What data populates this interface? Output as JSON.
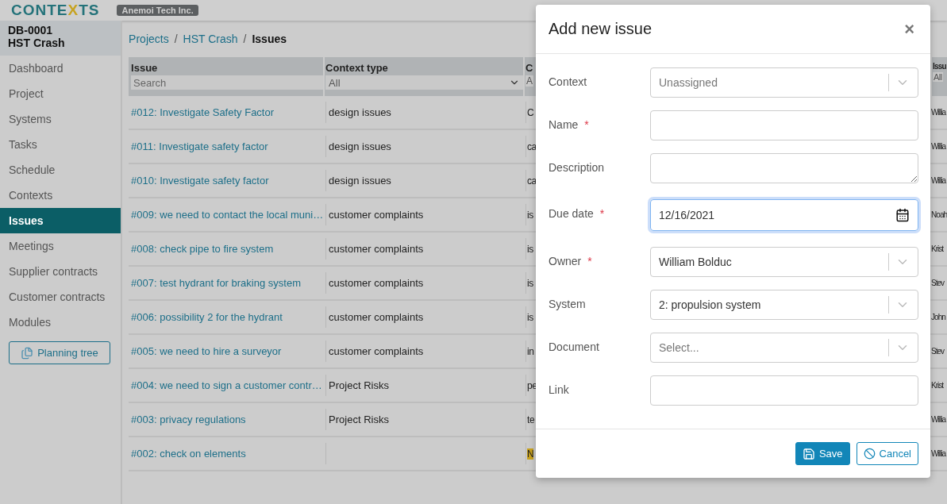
{
  "header": {
    "logo": {
      "before": "CONTE",
      "accent": "X",
      "after": "TS"
    },
    "company": "Anemoi Tech Inc."
  },
  "project": {
    "code": "DB-0001",
    "name": "HST Crash"
  },
  "sidebar": {
    "items": [
      {
        "label": "Dashboard",
        "selected": false
      },
      {
        "label": "Project",
        "selected": false
      },
      {
        "label": "Systems",
        "selected": false
      },
      {
        "label": "Tasks",
        "selected": false
      },
      {
        "label": "Schedule",
        "selected": false
      },
      {
        "label": "Contexts",
        "selected": false
      },
      {
        "label": "Issues",
        "selected": true
      },
      {
        "label": "Meetings",
        "selected": false
      },
      {
        "label": "Supplier contracts",
        "selected": false
      },
      {
        "label": "Customer contracts",
        "selected": false
      },
      {
        "label": "Modules",
        "selected": false
      }
    ],
    "button": "Planning tree"
  },
  "breadcrumb": [
    {
      "label": "Projects",
      "current": false
    },
    {
      "label": "HST Crash",
      "current": false
    },
    {
      "label": "Issues",
      "current": true
    }
  ],
  "breadcrumb_separator": "/",
  "table": {
    "columns": [
      {
        "title": "Issue",
        "filter": {
          "kind": "text",
          "placeholder": "Search"
        }
      },
      {
        "title": "Context type",
        "filter": {
          "kind": "select",
          "value": "All"
        }
      },
      {
        "title": "C",
        "filter": {
          "kind": "stub",
          "value": "A"
        }
      },
      {
        "title": "Issu",
        "filter": {
          "kind": "stub",
          "value": "All"
        }
      }
    ],
    "rows": [
      {
        "issue": "#012: Investigate Safety Factor",
        "context_type": "design issues",
        "column_3": "C",
        "column_4": "Willia",
        "highlight": false
      },
      {
        "issue": "#011: Investigate safety factor",
        "context_type": "design issues",
        "column_3": "ca",
        "column_4": "Willia",
        "highlight": false
      },
      {
        "issue": "#010: Investigate safety factor",
        "context_type": "design issues",
        "column_3": "ca",
        "column_4": "Willia",
        "highlight": false
      },
      {
        "issue": "#009: we need to contact the local muni…",
        "context_type": "customer complaints",
        "column_3": "is",
        "column_4": "Noah",
        "highlight": false
      },
      {
        "issue": "#008: check pipe to fire system",
        "context_type": "customer complaints",
        "column_3": "is",
        "column_4": "Krist",
        "highlight": false
      },
      {
        "issue": "#007: test hydrant for braking system",
        "context_type": "customer complaints",
        "column_3": "is",
        "column_4": "Stev",
        "highlight": false
      },
      {
        "issue": "#006: possibility 2 for the hydrant",
        "context_type": "customer complaints",
        "column_3": "is",
        "column_4": "John",
        "highlight": false
      },
      {
        "issue": "#005: we need to hire a surveyor",
        "context_type": "customer complaints",
        "column_3": "in",
        "column_4": "Stev",
        "highlight": false
      },
      {
        "issue": "#004: we need to sign a customer contr…",
        "context_type": "Project Risks",
        "column_3": "pe",
        "column_4": "Krist",
        "highlight": false
      },
      {
        "issue": "#003: privacy regulations",
        "context_type": "Project Risks",
        "column_3": "te",
        "column_4": "Willia",
        "highlight": false
      },
      {
        "issue": "#002: check on elements",
        "context_type": "",
        "column_3": "N",
        "column_4": "Willia",
        "highlight": true
      }
    ]
  },
  "modal": {
    "title": "Add new issue",
    "close": "×",
    "fields": [
      {
        "label": "Context",
        "kind": "select",
        "placeholder": "Unassigned"
      },
      {
        "label": "Name",
        "kind": "text",
        "required_mark": "*"
      },
      {
        "label": "Description",
        "kind": "textarea"
      },
      {
        "label": "Due date",
        "kind": "date",
        "value": "12/16/2021",
        "focused": true,
        "required_mark": "*"
      },
      {
        "label": "Owner",
        "kind": "select",
        "value": "William Bolduc",
        "required_mark": "*"
      },
      {
        "label": "System",
        "kind": "select",
        "value": "2: propulsion system"
      },
      {
        "label": "Document",
        "kind": "select",
        "placeholder": "Select..."
      },
      {
        "label": "Link",
        "kind": "text"
      }
    ],
    "buttons": [
      {
        "label": "Save",
        "kind": "primary"
      },
      {
        "label": "Cancel",
        "kind": "secondary"
      }
    ]
  }
}
